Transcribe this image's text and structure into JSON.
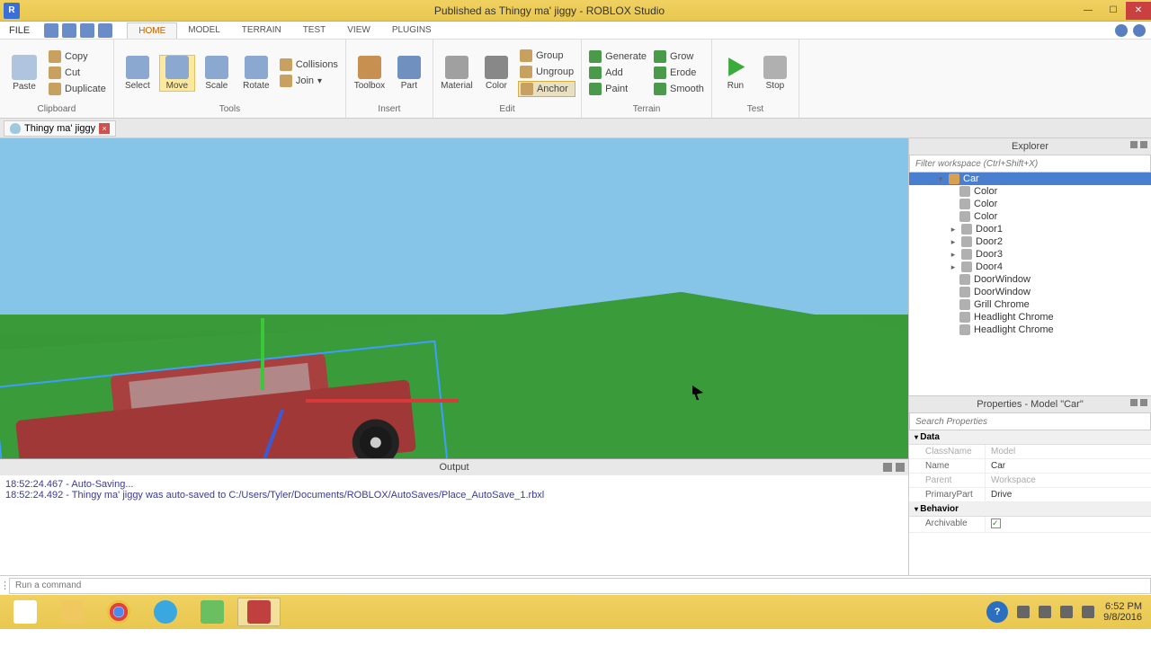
{
  "window": {
    "title": "Published as Thingy ma' jiggy - ROBLOX Studio",
    "app_icon_letter": "R"
  },
  "menu": {
    "file": "FILE",
    "tabs": [
      "HOME",
      "MODEL",
      "TERRAIN",
      "TEST",
      "VIEW",
      "PLUGINS"
    ],
    "active_index": 0
  },
  "ribbon": {
    "clipboard": {
      "label": "Clipboard",
      "paste": "Paste",
      "copy": "Copy",
      "cut": "Cut",
      "duplicate": "Duplicate"
    },
    "tools": {
      "label": "Tools",
      "select": "Select",
      "move": "Move",
      "scale": "Scale",
      "rotate": "Rotate",
      "collisions": "Collisions",
      "join": "Join"
    },
    "insert": {
      "label": "Insert",
      "toolbox": "Toolbox",
      "part": "Part"
    },
    "edit": {
      "label": "Edit",
      "material": "Material",
      "color": "Color",
      "group": "Group",
      "ungroup": "Ungroup",
      "anchor": "Anchor"
    },
    "terrain": {
      "label": "Terrain",
      "generate": "Generate",
      "add": "Add",
      "paint": "Paint",
      "grow": "Grow",
      "erode": "Erode",
      "smooth": "Smooth"
    },
    "test": {
      "label": "Test",
      "run": "Run",
      "stop": "Stop"
    }
  },
  "doctab": {
    "name": "Thingy ma' jiggy"
  },
  "explorer": {
    "title": "Explorer",
    "filter_placeholder": "Filter workspace (Ctrl+Shift+X)",
    "selected": "Car",
    "children": [
      {
        "label": "Color",
        "expandable": false
      },
      {
        "label": "Color",
        "expandable": false
      },
      {
        "label": "Color",
        "expandable": false
      },
      {
        "label": "Door1",
        "expandable": true
      },
      {
        "label": "Door2",
        "expandable": true
      },
      {
        "label": "Door3",
        "expandable": true
      },
      {
        "label": "Door4",
        "expandable": true
      },
      {
        "label": "DoorWindow",
        "expandable": false
      },
      {
        "label": "DoorWindow",
        "expandable": false
      },
      {
        "label": "Grill Chrome",
        "expandable": false
      },
      {
        "label": "Headlight Chrome",
        "expandable": false
      },
      {
        "label": "Headlight Chrome",
        "expandable": false
      }
    ]
  },
  "properties": {
    "title": "Properties - Model \"Car\"",
    "search_placeholder": "Search Properties",
    "categories": {
      "data": {
        "label": "Data",
        "rows": [
          {
            "k": "ClassName",
            "v": "Model",
            "ro": true
          },
          {
            "k": "Name",
            "v": "Car",
            "ro": false
          },
          {
            "k": "Parent",
            "v": "Workspace",
            "ro": true
          },
          {
            "k": "PrimaryPart",
            "v": "Drive",
            "ro": false
          }
        ]
      },
      "behavior": {
        "label": "Behavior",
        "archivable": "Archivable"
      }
    }
  },
  "output": {
    "title": "Output",
    "lines": [
      "18:52:24.467 - Auto-Saving...",
      "18:52:24.492 - Thingy ma' jiggy was auto-saved to C:/Users/Tyler/Documents/ROBLOX/AutoSaves/Place_AutoSave_1.rbxl"
    ]
  },
  "cmd": {
    "placeholder": "Run a command"
  },
  "taskbar": {
    "time": "6:52 PM",
    "date": "9/8/2016",
    "help": "?"
  },
  "colors": {
    "accent": "#e8c850",
    "selection": "#4a7fd0",
    "car": "#a03838",
    "grass": "#3a9b3a",
    "sky": "#87c5e8"
  }
}
